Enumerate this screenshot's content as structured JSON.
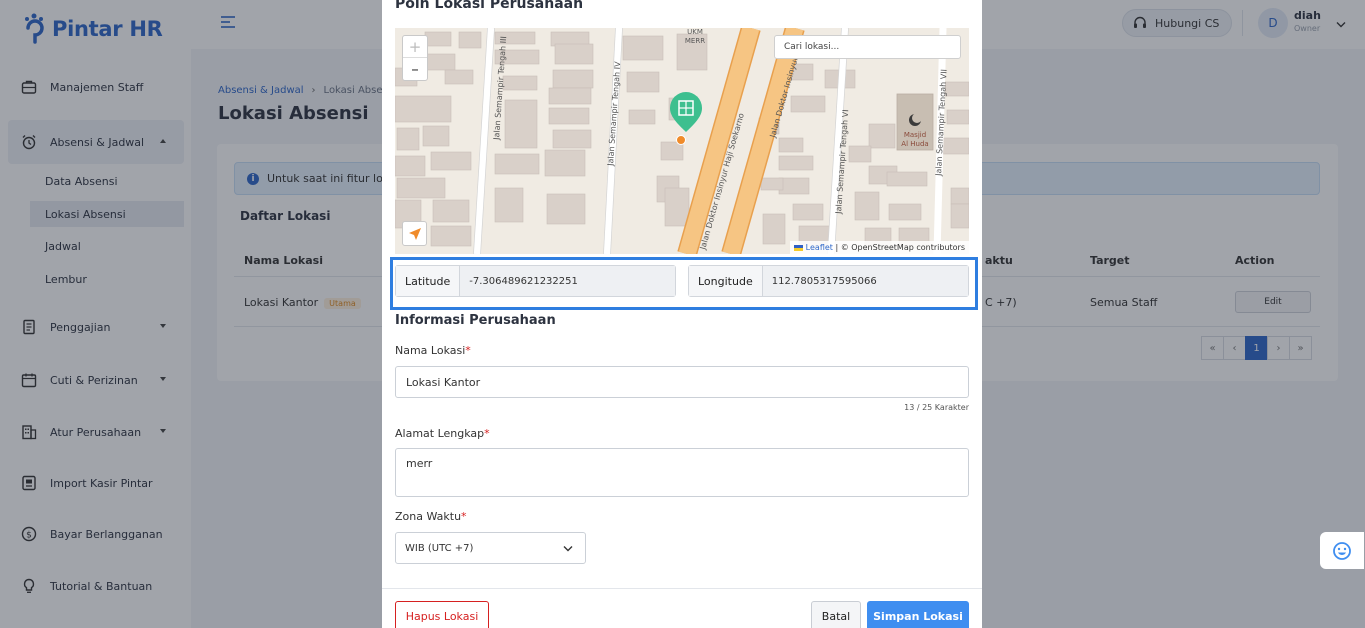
{
  "app": {
    "logo_text": "Pintar HR",
    "accent_color": "#2e67c9"
  },
  "sidebar": {
    "items": [
      {
        "label": "Manajemen Staff",
        "icon": "briefcase-icon"
      },
      {
        "label": "Absensi & Jadwal",
        "icon": "alarm-clock-icon"
      },
      {
        "label": "Penggajian",
        "icon": "document-icon"
      },
      {
        "label": "Cuti & Perizinan",
        "icon": "calendar-icon"
      },
      {
        "label": "Atur Perusahaan",
        "icon": "building-icon"
      },
      {
        "label": "Import Kasir Pintar",
        "icon": "import-icon"
      },
      {
        "label": "Bayar Berlangganan",
        "icon": "dollar-icon"
      },
      {
        "label": "Tutorial & Bantuan",
        "icon": "lightbulb-icon"
      }
    ],
    "sub_items": [
      {
        "label": "Data Absensi"
      },
      {
        "label": "Lokasi Absensi"
      },
      {
        "label": "Jadwal"
      },
      {
        "label": "Lembur"
      }
    ]
  },
  "topbar": {
    "contact_label": "Hubungi CS",
    "user_initial": "D",
    "user_name": "diah",
    "user_role": "Owner"
  },
  "page": {
    "breadcrumb_parent": "Absensi & Jadwal",
    "breadcrumb_current": "Lokasi Absensi",
    "title": "Lokasi Absensi",
    "info_text": "Untuk saat ini fitur lok",
    "list_title": "Daftar Lokasi",
    "table": {
      "headers": [
        "Nama Lokasi",
        "aktu",
        "Target",
        "Action"
      ],
      "rows": [
        {
          "name": "Lokasi Kantor",
          "badge": "Utama",
          "time": "C +7)",
          "target": "Semua Staff",
          "action": "Edit"
        }
      ]
    },
    "pager": {
      "first": "«",
      "prev": "‹",
      "current": "1",
      "next": "›",
      "last": "»"
    }
  },
  "modal": {
    "title": "Poin Lokasi Perusahaan",
    "map": {
      "search_placeholder": "Cari lokasi...",
      "zoom_in": "+",
      "zoom_out": "–",
      "attribution_link": "Leaflet",
      "attribution_text": "| © OpenStreetMap contributors",
      "labels": {
        "street_1": "Jalan Semampir Tengah III",
        "street_2": "Jalan Semampir Tengah IV",
        "street_3": "Jalan Doktor Insinyur Haji Soekarno",
        "street_4": "Jalan Doktor Insinyur",
        "street_5": "Jalan Semampir Tengah VI",
        "street_6": "Jalan Semampir Tengah VII",
        "poi_1_line1": "UKM",
        "poi_1_line2": "MERR",
        "poi_2_line1": "Masjid",
        "poi_2_line2": "Al Huda"
      },
      "marker_color": "#3dbf8f"
    },
    "latitude_label": "Latitude",
    "latitude_value": "-7.306489621232251",
    "longitude_label": "Longitude",
    "longitude_value": "112.7805317595066",
    "section_title": "Informasi Perusahaan",
    "name_label": "Nama Lokasi",
    "name_value": "Lokasi Kantor",
    "name_counter": "13 / 25 Karakter",
    "address_label": "Alamat Lengkap",
    "address_value": "merr",
    "timezone_label": "Zona Waktu",
    "timezone_value": "WIB (UTC +7)",
    "required_mark": "*",
    "delete_label": "Hapus Lokasi",
    "cancel_label": "Batal",
    "save_label": "Simpan Lokasi"
  }
}
